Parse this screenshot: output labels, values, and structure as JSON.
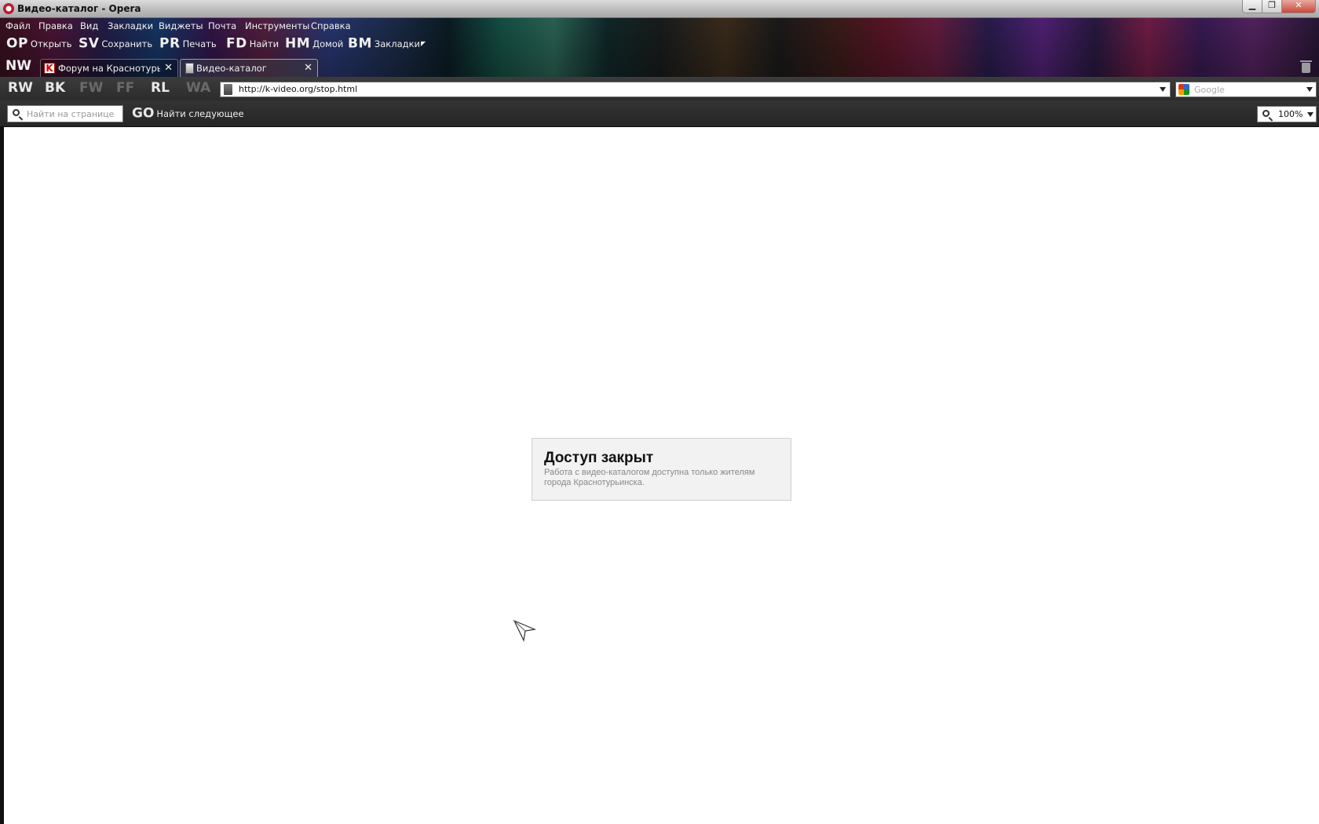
{
  "window": {
    "title": "Видео-каталог - Opera"
  },
  "menu": {
    "items": [
      "Файл",
      "Правка",
      "Вид",
      "Закладки",
      "Виджеты",
      "Почта",
      "Инструменты",
      "Справка"
    ]
  },
  "toolbar": {
    "buttons": [
      {
        "code": "OP",
        "label": "Открыть"
      },
      {
        "code": "SV",
        "label": "Сохранить"
      },
      {
        "code": "PR",
        "label": "Печать"
      },
      {
        "code": "FD",
        "label": "Найти"
      },
      {
        "code": "HM",
        "label": "Домой"
      },
      {
        "code": "BM",
        "label": "Закладки"
      }
    ]
  },
  "tabs": {
    "new_tab_code": "NW",
    "items": [
      {
        "label": "Форум на Краснотурьи...",
        "close": "✕",
        "favicon": "K"
      },
      {
        "label": "Видео-каталог",
        "close": "✕"
      }
    ]
  },
  "nav": {
    "buttons": [
      "RW",
      "BK",
      "FW",
      "FF",
      "RL",
      "WA"
    ]
  },
  "address": {
    "url": "http://k-video.org/stop.html"
  },
  "search": {
    "placeholder": "Google"
  },
  "find": {
    "placeholder": "Найти на странице",
    "next_code": "GO",
    "next_label": "Найти следующее"
  },
  "zoom": {
    "value": "100%"
  },
  "page": {
    "notice_title": "Доступ закрыт",
    "notice_text": "Работа с видео-каталогом доступна только жителям города Краснотурьинска."
  },
  "colors": {
    "notice_bg": "#f2f2f2",
    "chrome_dark": "#2c2c2c",
    "close_red": "#c7493a"
  }
}
